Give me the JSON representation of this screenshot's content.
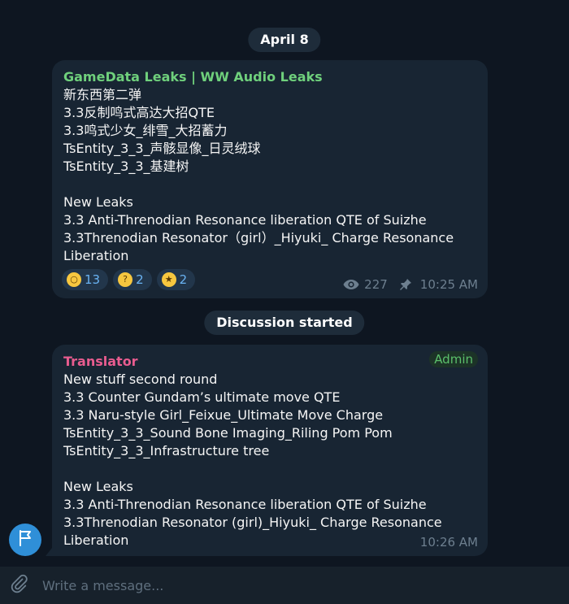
{
  "date_pill": "April 8",
  "system_pill": "Discussion started",
  "post": {
    "channel": "GameData Leaks | WW Audio Leaks",
    "lines": [
      "新东西第二弹",
      "3.3反制鸣式高达大招QTE",
      "3.3鸣式少女_绯雪_大招蓄力",
      "TsEntity_3_3_声骸显像_日灵绒球",
      "TsEntity_3_3_基建树",
      "",
      "New Leaks",
      "3.3 Anti-Threnodian Resonance liberation QTE of Suizhe",
      "3.3Threnodian Resonator（girl）_Hiyuki_ Charge Resonance",
      "Liberation"
    ],
    "reactions": [
      {
        "emoji": "scream-emoji",
        "count": "13"
      },
      {
        "emoji": "thinking-emoji",
        "count": "2"
      },
      {
        "emoji": "star-struck-emoji",
        "count": "2"
      }
    ],
    "views": "227",
    "time": "10:25 AM"
  },
  "comment": {
    "sender": "Translator",
    "badge": "Admin",
    "lines": [
      "New stuff second round",
      "3.3 Counter Gundam’s ultimate move QTE",
      "3.3 Naru-style Girl_Feixue_Ultimate Move Charge",
      "TsEntity_3_3_Sound Bone Imaging_Riling Pom Pom",
      "TsEntity_3_3_Infrastructure tree",
      "",
      "New Leaks",
      "3.3 Anti-Threnodian Resonance liberation QTE of Suizhe",
      "3.3Threnodian Resonator (girl)_Hiyuki_ Charge Resonance",
      "Liberation"
    ],
    "time": "10:26 AM"
  },
  "composer": {
    "placeholder": "Write a message..."
  },
  "colors": {
    "background": "#0e1621",
    "bubble": "#182533",
    "channel_name": "#6fd07c",
    "translator_name": "#e85c8f",
    "admin_badge": "#5bbf6a",
    "accent": "#6ab3f3"
  }
}
